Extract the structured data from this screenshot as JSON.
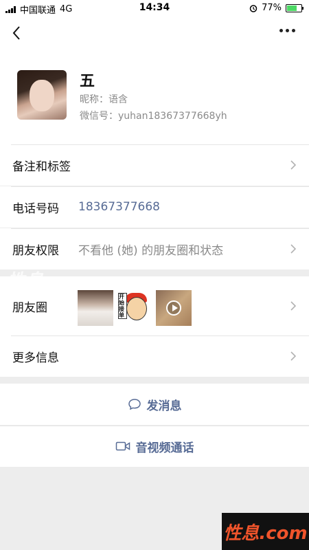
{
  "status_bar": {
    "carrier": "中国联通",
    "network": "4G",
    "time": "14:34",
    "battery": "77%",
    "battery_level": 0.77
  },
  "profile": {
    "name": "五",
    "nickname": "昵称：语含",
    "wechat_id": "微信号：yuhan18367377668yh"
  },
  "rows": {
    "remarks_label": "备注和标签",
    "phone_label": "电话号码",
    "phone_value": "18367377668",
    "privacy_label": "朋友权限",
    "privacy_value": "不看他 (她) 的朋友圈和状态",
    "moments_label": "朋友圈",
    "more_info_label": "更多信息"
  },
  "moments_thumbnails": [
    {
      "icon": "photo"
    },
    {
      "icon": "sticker",
      "text": "开始接单"
    },
    {
      "icon": "video"
    }
  ],
  "actions": {
    "send_message": "发消息",
    "video_call": "音视频通话"
  },
  "watermarks": {
    "top": "性息.com",
    "bottom": "性息.com"
  },
  "colors": {
    "link": "#576b95",
    "battery_green": "#4cd964",
    "background": "#ededed"
  }
}
